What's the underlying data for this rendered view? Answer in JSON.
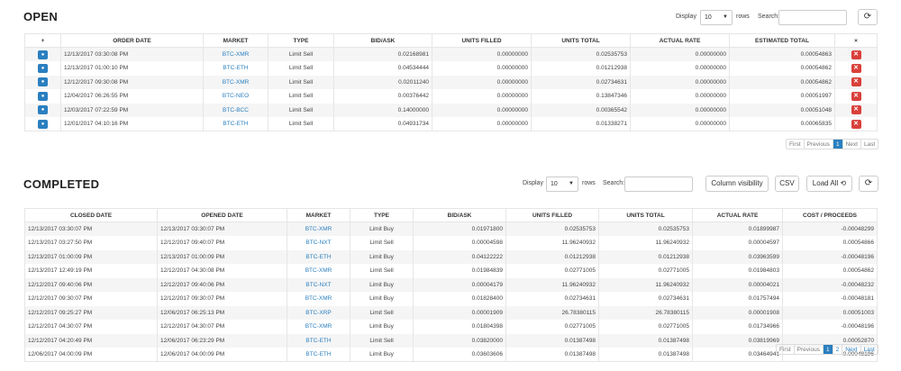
{
  "open": {
    "title": "OPEN",
    "display_label": "Display",
    "display_value": "10",
    "rows_label": "rows",
    "search_label": "Search:",
    "refresh_icon": "refresh-icon",
    "headers": [
      "+",
      "ORDER DATE",
      "MARKET",
      "TYPE",
      "BID/ASK",
      "UNITS FILLED",
      "UNITS TOTAL",
      "ACTUAL RATE",
      "ESTIMATED TOTAL",
      "×"
    ],
    "rows": [
      {
        "date": "12/13/2017 03:30:08 PM",
        "market": "BTC-XMR",
        "type": "Limit Sell",
        "bid": "0.02168981",
        "filled": "0.00000000",
        "total": "0.02535753",
        "rate": "0.00000000",
        "est": "0.00054863"
      },
      {
        "date": "12/13/2017 01:00:10 PM",
        "market": "BTC-ETH",
        "type": "Limit Sell",
        "bid": "0.04534444",
        "filled": "0.00000000",
        "total": "0.01212938",
        "rate": "0.00000000",
        "est": "0.00054862"
      },
      {
        "date": "12/12/2017 09:30:08 PM",
        "market": "BTC-XMR",
        "type": "Limit Sell",
        "bid": "0.02011240",
        "filled": "0.00000000",
        "total": "0.02734631",
        "rate": "0.00000000",
        "est": "0.00054862"
      },
      {
        "date": "12/04/2017 06:26:55 PM",
        "market": "BTC-NEO",
        "type": "Limit Sell",
        "bid": "0.00376442",
        "filled": "0.00000000",
        "total": "0.13847346",
        "rate": "0.00000000",
        "est": "0.00051997"
      },
      {
        "date": "12/03/2017 07:22:59 PM",
        "market": "BTC-BCC",
        "type": "Limit Sell",
        "bid": "0.14000000",
        "filled": "0.00000000",
        "total": "0.00365542",
        "rate": "0.00000000",
        "est": "0.00051048"
      },
      {
        "date": "12/01/2017 04:10:16 PM",
        "market": "BTC-ETH",
        "type": "Limit Sell",
        "bid": "0.04931734",
        "filled": "0.00000000",
        "total": "0.01338271",
        "rate": "0.00000000",
        "est": "0.00065835"
      }
    ],
    "pager": {
      "first": "First",
      "previous": "Previous",
      "page1": "1",
      "next": "Next",
      "last": "Last"
    }
  },
  "completed": {
    "title": "COMPLETED",
    "display_label": "Display",
    "display_value": "10",
    "rows_label": "rows",
    "search_label": "Search:",
    "column_visibility": "Column visibility",
    "csv": "CSV",
    "load_all": "Load All",
    "headers": [
      "CLOSED DATE",
      "OPENED DATE",
      "MARKET",
      "TYPE",
      "BID/ASK",
      "UNITS FILLED",
      "UNITS TOTAL",
      "ACTUAL RATE",
      "COST / PROCEEDS"
    ],
    "rows": [
      {
        "closed": "12/13/2017 03:30:07 PM",
        "opened": "12/13/2017 03:30:07 PM",
        "market": "BTC-XMR",
        "type": "Limit Buy",
        "bid": "0.01971800",
        "filled": "0.02535753",
        "total": "0.02535753",
        "rate": "0.01899987",
        "cost": "-0.00048299"
      },
      {
        "closed": "12/13/2017 03:27:50 PM",
        "opened": "12/12/2017 09:40:07 PM",
        "market": "BTC-NXT",
        "type": "Limit Sell",
        "bid": "0.00004598",
        "filled": "11.96240932",
        "total": "11.96240932",
        "rate": "0.00004597",
        "cost": "0.00054866"
      },
      {
        "closed": "12/13/2017 01:00:09 PM",
        "opened": "12/13/2017 01:00:09 PM",
        "market": "BTC-ETH",
        "type": "Limit Buy",
        "bid": "0.04122222",
        "filled": "0.01212938",
        "total": "0.01212938",
        "rate": "0.03963599",
        "cost": "-0.00048196"
      },
      {
        "closed": "12/13/2017 12:49:19 PM",
        "opened": "12/12/2017 04:30:08 PM",
        "market": "BTC-XMR",
        "type": "Limit Sell",
        "bid": "0.01984839",
        "filled": "0.02771005",
        "total": "0.02771005",
        "rate": "0.01984803",
        "cost": "0.00054862"
      },
      {
        "closed": "12/12/2017 09:40:06 PM",
        "opened": "12/12/2017 09:40:06 PM",
        "market": "BTC-NXT",
        "type": "Limit Buy",
        "bid": "0.00004179",
        "filled": "11.96240932",
        "total": "11.96240932",
        "rate": "0.00004021",
        "cost": "-0.00048232"
      },
      {
        "closed": "12/12/2017 09:30:07 PM",
        "opened": "12/12/2017 09:30:07 PM",
        "market": "BTC-XMR",
        "type": "Limit Buy",
        "bid": "0.01828400",
        "filled": "0.02734631",
        "total": "0.02734631",
        "rate": "0.01757494",
        "cost": "-0.00048181"
      },
      {
        "closed": "12/12/2017 09:25:27 PM",
        "opened": "12/06/2017 06:25:13 PM",
        "market": "BTC-XRP",
        "type": "Limit Sell",
        "bid": "0.00001909",
        "filled": "26.78380115",
        "total": "26.78380115",
        "rate": "0.00001908",
        "cost": "0.00051003"
      },
      {
        "closed": "12/12/2017 04:30:07 PM",
        "opened": "12/12/2017 04:30:07 PM",
        "market": "BTC-XMR",
        "type": "Limit Buy",
        "bid": "0.01804398",
        "filled": "0.02771005",
        "total": "0.02771005",
        "rate": "0.01734966",
        "cost": "-0.00048196"
      },
      {
        "closed": "12/12/2017 04:20:49 PM",
        "opened": "12/06/2017 06:23:29 PM",
        "market": "BTC-ETH",
        "type": "Limit Sell",
        "bid": "0.03820000",
        "filled": "0.01387498",
        "total": "0.01387498",
        "rate": "0.03819969",
        "cost": "0.00052870"
      },
      {
        "closed": "12/06/2017 04:00:09 PM",
        "opened": "12/06/2017 04:00:09 PM",
        "market": "BTC-ETH",
        "type": "Limit Buy",
        "bid": "0.03603606",
        "filled": "0.01387498",
        "total": "0.01387498",
        "rate": "0.03464941",
        "cost": "-0.00048196"
      }
    ],
    "pager": {
      "first": "First",
      "previous": "Previous",
      "page1": "1",
      "page2": "2",
      "next": "Next",
      "last": "Last"
    }
  },
  "colors": {
    "accent": "#2a7fc0",
    "danger": "#d9403a"
  }
}
